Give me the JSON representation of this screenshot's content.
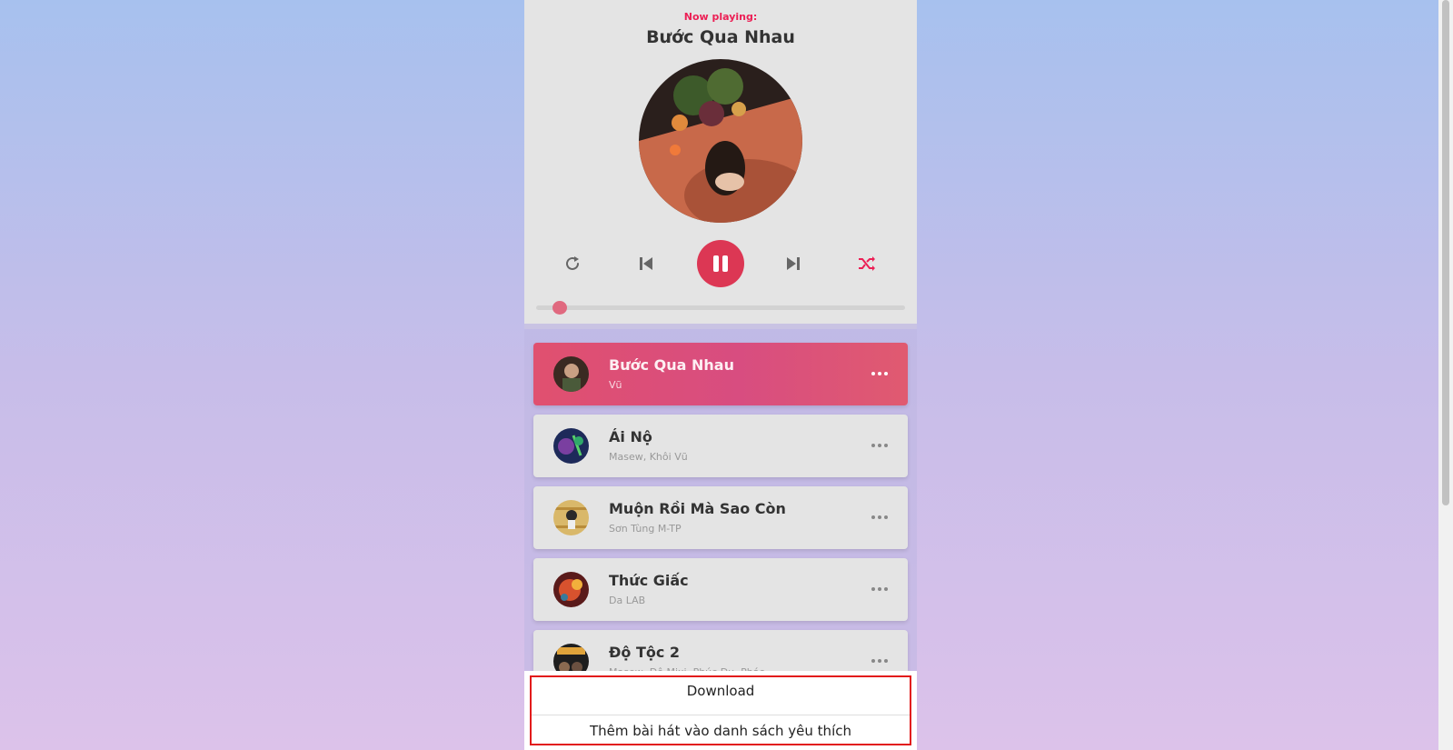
{
  "dashboard": {
    "now_label": "Now playing:",
    "title": "Bước Qua Nhau",
    "progress": 0.065
  },
  "controls": {
    "repeat_icon": "repeat-icon",
    "prev_icon": "skip-back-icon",
    "pause_icon": "pause-icon",
    "next_icon": "skip-forward-icon",
    "shuffle_icon": "shuffle-icon"
  },
  "colors": {
    "accent": "#ec1f55",
    "play_button": "#dc3754",
    "shuffle_active": "#ec1f55"
  },
  "playlist": [
    {
      "name": "Bước Qua Nhau",
      "artist": "Vũ",
      "active": true
    },
    {
      "name": "Ái Nộ",
      "artist": "Masew, Khôi Vũ",
      "active": false
    },
    {
      "name": "Muộn Rồi Mà Sao Còn",
      "artist": "Sơn Tùng M-TP",
      "active": false
    },
    {
      "name": "Thức Giấc",
      "artist": "Da LAB",
      "active": false
    },
    {
      "name": "Độ Tộc 2",
      "artist": "Masew, Độ Mixi, Phúc Du, Pháo",
      "active": false
    }
  ],
  "menu": {
    "download": "Download",
    "add_favorite": "Thêm bài hát vào danh sách yêu thích"
  }
}
